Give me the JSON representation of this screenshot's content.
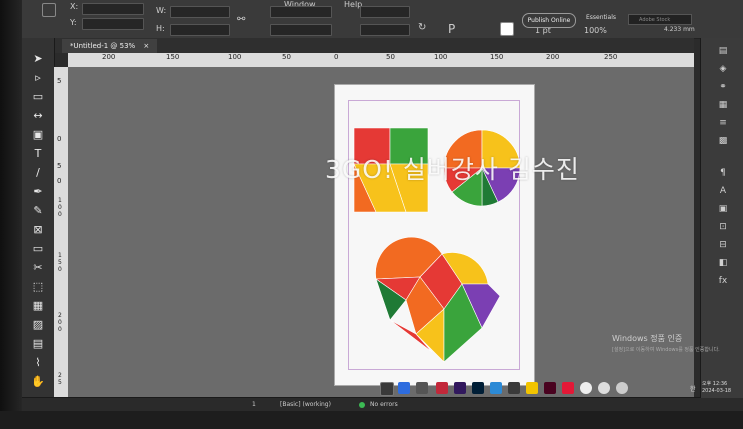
{
  "control_bar": {
    "menu_items": [
      "Window",
      "Help"
    ],
    "x_label": "X:",
    "y_label": "Y:",
    "w_label": "W:",
    "h_label": "H:",
    "publish_button": "Publish Online",
    "workspace": "Essentials",
    "search_placeholder": "Adobe Stock",
    "stroke_value": "1 pt",
    "zoom_value": "100%",
    "size_value": "4.233 mm"
  },
  "document_tab": {
    "label": "*Untitled-1 @ 53%",
    "close": "×"
  },
  "ruler": {
    "horizontal": [
      "200",
      "150",
      "100",
      "50",
      "0",
      "50",
      "100",
      "150",
      "200",
      "250"
    ],
    "vertical": [
      "5",
      "0",
      "5",
      "0",
      "1\n0\n0",
      "1\n5\n0",
      "2\n0\n0",
      "2\n5"
    ]
  },
  "watermark": "3GO! 실버강사 김수진",
  "artwork": {
    "colors": {
      "red": "#e53935",
      "orange": "#f26a21",
      "yellow": "#f7c21b",
      "green": "#3aa43c",
      "dark_green": "#1f7a35",
      "purple": "#7b3fb3"
    }
  },
  "activation": {
    "title": "Windows 정품 인증",
    "subtitle": "[설정]으로 이동하여 Windows를 정품 인증합니다."
  },
  "status_bar": {
    "page": "1",
    "style": "[Basic] (working)",
    "preflight": "No errors"
  },
  "tray": {
    "lang": "한",
    "time": "오후 12:36",
    "date": "2024-03-18"
  }
}
